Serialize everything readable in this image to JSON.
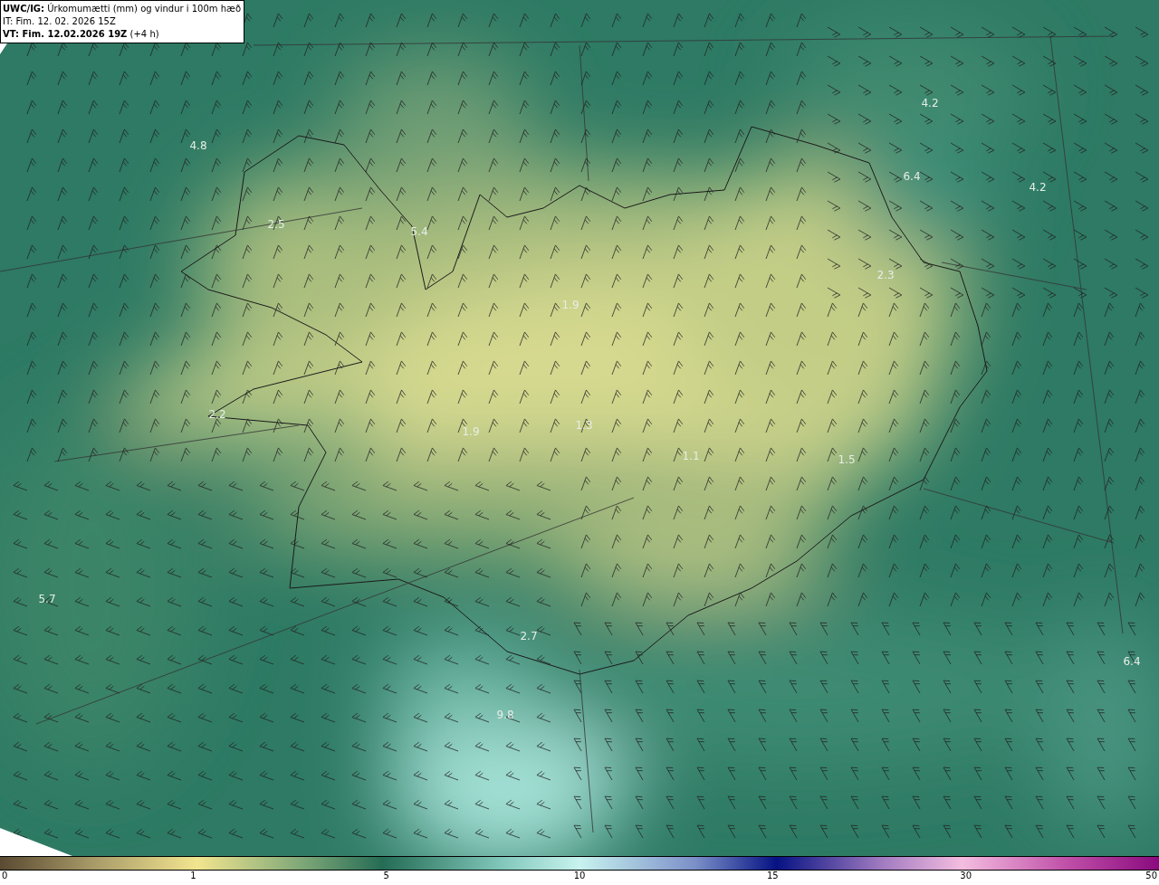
{
  "header": {
    "title": "**UWC/IG:** Úrkomumætti (mm) og vindur i 100m hæð",
    "init_time": "IT: Fim. 12. 02. 2026 15Z",
    "valid_time": "**VT: Fim. 12.02.2026 19Z** (+4 h)"
  },
  "map": {
    "value_labels": [
      {
        "text": "4.8"
      },
      {
        "text": "2.5"
      },
      {
        "text": "5.4"
      },
      {
        "text": "4.2"
      },
      {
        "text": "6.4"
      },
      {
        "text": "4.2"
      },
      {
        "text": "2.3"
      },
      {
        "text": "1.9"
      },
      {
        "text": "2.2"
      },
      {
        "text": "1.9"
      },
      {
        "text": "1.3"
      },
      {
        "text": "1.1"
      },
      {
        "text": "1.5"
      },
      {
        "text": "5.7"
      },
      {
        "text": "2.7"
      },
      {
        "text": "9.8"
      },
      {
        "text": "6.4"
      }
    ]
  },
  "colorbar": {
    "ticks": [
      "0",
      "1",
      "5",
      "10",
      "15",
      "30",
      "50"
    ]
  }
}
